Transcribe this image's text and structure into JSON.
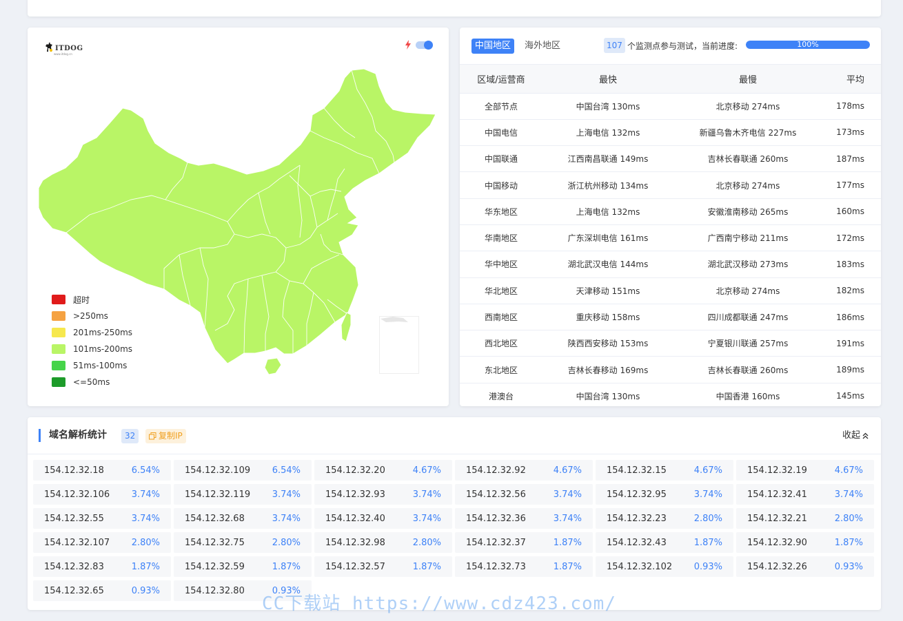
{
  "map": {
    "logo_text": "ITDOG",
    "logo_sub": "www.itdog.cn",
    "fill_color": "#b9f566",
    "legend": [
      {
        "label": "超时",
        "color": "#e01b1b"
      },
      {
        "label": ">250ms",
        "color": "#f5a242"
      },
      {
        "label": "201ms-250ms",
        "color": "#f6e84e"
      },
      {
        "label": "101ms-200ms",
        "color": "#b9f566"
      },
      {
        "label": "51ms-100ms",
        "color": "#46d44a"
      },
      {
        "label": "<=50ms",
        "color": "#1d9b2a"
      }
    ]
  },
  "stats": {
    "tab_china": "中国地区",
    "tab_overseas": "海外地区",
    "node_count": "107",
    "count_text": "个监测点参与测试，当前进度:",
    "progress_label": "100%",
    "progress_value": 100,
    "columns": [
      "区域/运营商",
      "最快",
      "最慢",
      "平均"
    ],
    "rows": [
      {
        "region": "全部节点",
        "fastest": "中国台湾 130ms",
        "slowest": "北京移动 274ms",
        "avg": "178ms"
      },
      {
        "region": "中国电信",
        "fastest": "上海电信 132ms",
        "slowest": "新疆乌鲁木齐电信 227ms",
        "avg": "173ms"
      },
      {
        "region": "中国联通",
        "fastest": "江西南昌联通 149ms",
        "slowest": "吉林长春联通 260ms",
        "avg": "187ms"
      },
      {
        "region": "中国移动",
        "fastest": "浙江杭州移动 134ms",
        "slowest": "北京移动 274ms",
        "avg": "177ms"
      },
      {
        "region": "华东地区",
        "fastest": "上海电信 132ms",
        "slowest": "安徽淮南移动 265ms",
        "avg": "160ms"
      },
      {
        "region": "华南地区",
        "fastest": "广东深圳电信 161ms",
        "slowest": "广西南宁移动 211ms",
        "avg": "172ms"
      },
      {
        "region": "华中地区",
        "fastest": "湖北武汉电信 144ms",
        "slowest": "湖北武汉移动 273ms",
        "avg": "183ms"
      },
      {
        "region": "华北地区",
        "fastest": "天津移动 151ms",
        "slowest": "北京移动 274ms",
        "avg": "182ms"
      },
      {
        "region": "西南地区",
        "fastest": "重庆移动 158ms",
        "slowest": "四川成都联通 247ms",
        "avg": "186ms"
      },
      {
        "region": "西北地区",
        "fastest": "陕西西安移动 153ms",
        "slowest": "宁夏银川联通 257ms",
        "avg": "191ms"
      },
      {
        "region": "东北地区",
        "fastest": "吉林长春移动 169ms",
        "slowest": "吉林长春联通 260ms",
        "avg": "189ms"
      },
      {
        "region": "港澳台",
        "fastest": "中国台湾 130ms",
        "slowest": "中国香港 160ms",
        "avg": "145ms"
      }
    ]
  },
  "dns": {
    "title": "域名解析统计",
    "count": "32",
    "copy_label": "复制IP",
    "collapse_label": "收起",
    "ips": [
      {
        "ip": "154.12.32.18",
        "pct": "6.54%"
      },
      {
        "ip": "154.12.32.109",
        "pct": "6.54%"
      },
      {
        "ip": "154.12.32.20",
        "pct": "4.67%"
      },
      {
        "ip": "154.12.32.92",
        "pct": "4.67%"
      },
      {
        "ip": "154.12.32.15",
        "pct": "4.67%"
      },
      {
        "ip": "154.12.32.19",
        "pct": "4.67%"
      },
      {
        "ip": "154.12.32.106",
        "pct": "3.74%"
      },
      {
        "ip": "154.12.32.119",
        "pct": "3.74%"
      },
      {
        "ip": "154.12.32.93",
        "pct": "3.74%"
      },
      {
        "ip": "154.12.32.56",
        "pct": "3.74%"
      },
      {
        "ip": "154.12.32.95",
        "pct": "3.74%"
      },
      {
        "ip": "154.12.32.41",
        "pct": "3.74%"
      },
      {
        "ip": "154.12.32.55",
        "pct": "3.74%"
      },
      {
        "ip": "154.12.32.68",
        "pct": "3.74%"
      },
      {
        "ip": "154.12.32.40",
        "pct": "3.74%"
      },
      {
        "ip": "154.12.32.36",
        "pct": "3.74%"
      },
      {
        "ip": "154.12.32.23",
        "pct": "2.80%"
      },
      {
        "ip": "154.12.32.21",
        "pct": "2.80%"
      },
      {
        "ip": "154.12.32.107",
        "pct": "2.80%"
      },
      {
        "ip": "154.12.32.75",
        "pct": "2.80%"
      },
      {
        "ip": "154.12.32.98",
        "pct": "2.80%"
      },
      {
        "ip": "154.12.32.37",
        "pct": "1.87%"
      },
      {
        "ip": "154.12.32.43",
        "pct": "1.87%"
      },
      {
        "ip": "154.12.32.90",
        "pct": "1.87%"
      },
      {
        "ip": "154.12.32.83",
        "pct": "1.87%"
      },
      {
        "ip": "154.12.32.59",
        "pct": "1.87%"
      },
      {
        "ip": "154.12.32.57",
        "pct": "1.87%"
      },
      {
        "ip": "154.12.32.73",
        "pct": "1.87%"
      },
      {
        "ip": "154.12.32.102",
        "pct": "0.93%"
      },
      {
        "ip": "154.12.32.26",
        "pct": "0.93%"
      },
      {
        "ip": "154.12.32.65",
        "pct": "0.93%"
      },
      {
        "ip": "154.12.32.80",
        "pct": "0.93%"
      }
    ]
  },
  "watermark": "CC下载站 https://www.cdz423.com/"
}
